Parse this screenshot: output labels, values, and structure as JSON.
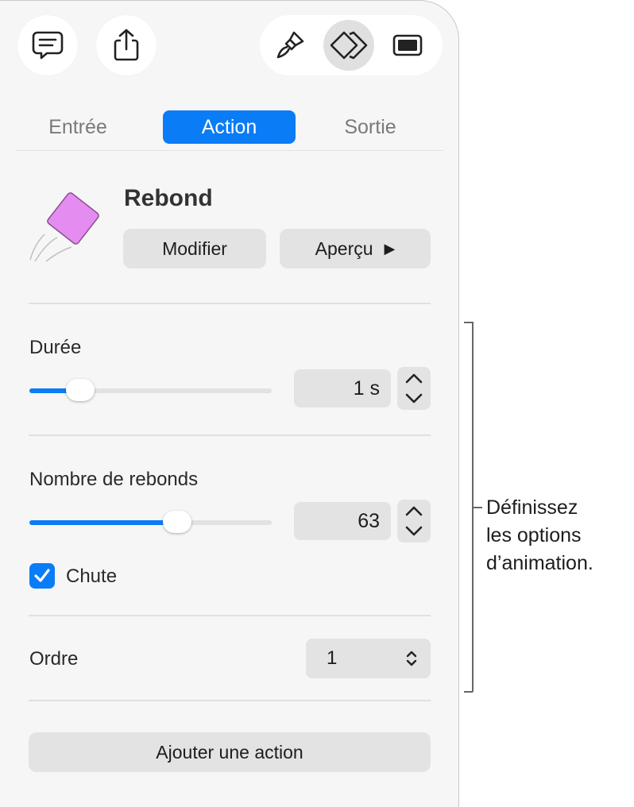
{
  "toolbar": {
    "buttons": [
      {
        "name": "comment-icon"
      },
      {
        "name": "share-icon"
      },
      {
        "name": "paintbrush-icon"
      },
      {
        "name": "animate-icon",
        "active": true
      },
      {
        "name": "document-icon"
      }
    ]
  },
  "tabs": [
    {
      "label": "Entrée",
      "active": false
    },
    {
      "label": "Action",
      "active": true
    },
    {
      "label": "Sortie",
      "active": false
    }
  ],
  "effect": {
    "name": "Rebond",
    "modify_label": "Modifier",
    "preview_label": "Aperçu",
    "preview_icon": "▶"
  },
  "duration": {
    "label": "Durée",
    "value": "1 s",
    "slider_fraction": 0.21
  },
  "bounces": {
    "label": "Nombre de rebonds",
    "value": "63",
    "slider_fraction": 0.61
  },
  "fall": {
    "label": "Chute",
    "checked": true
  },
  "order": {
    "label": "Ordre",
    "value": "1"
  },
  "add_action_label": "Ajouter une action",
  "callout": {
    "lines": [
      "Définissez",
      "les options",
      "d’animation."
    ]
  },
  "colors": {
    "accent": "#0a7cf6",
    "shape": "#e58cf0"
  }
}
